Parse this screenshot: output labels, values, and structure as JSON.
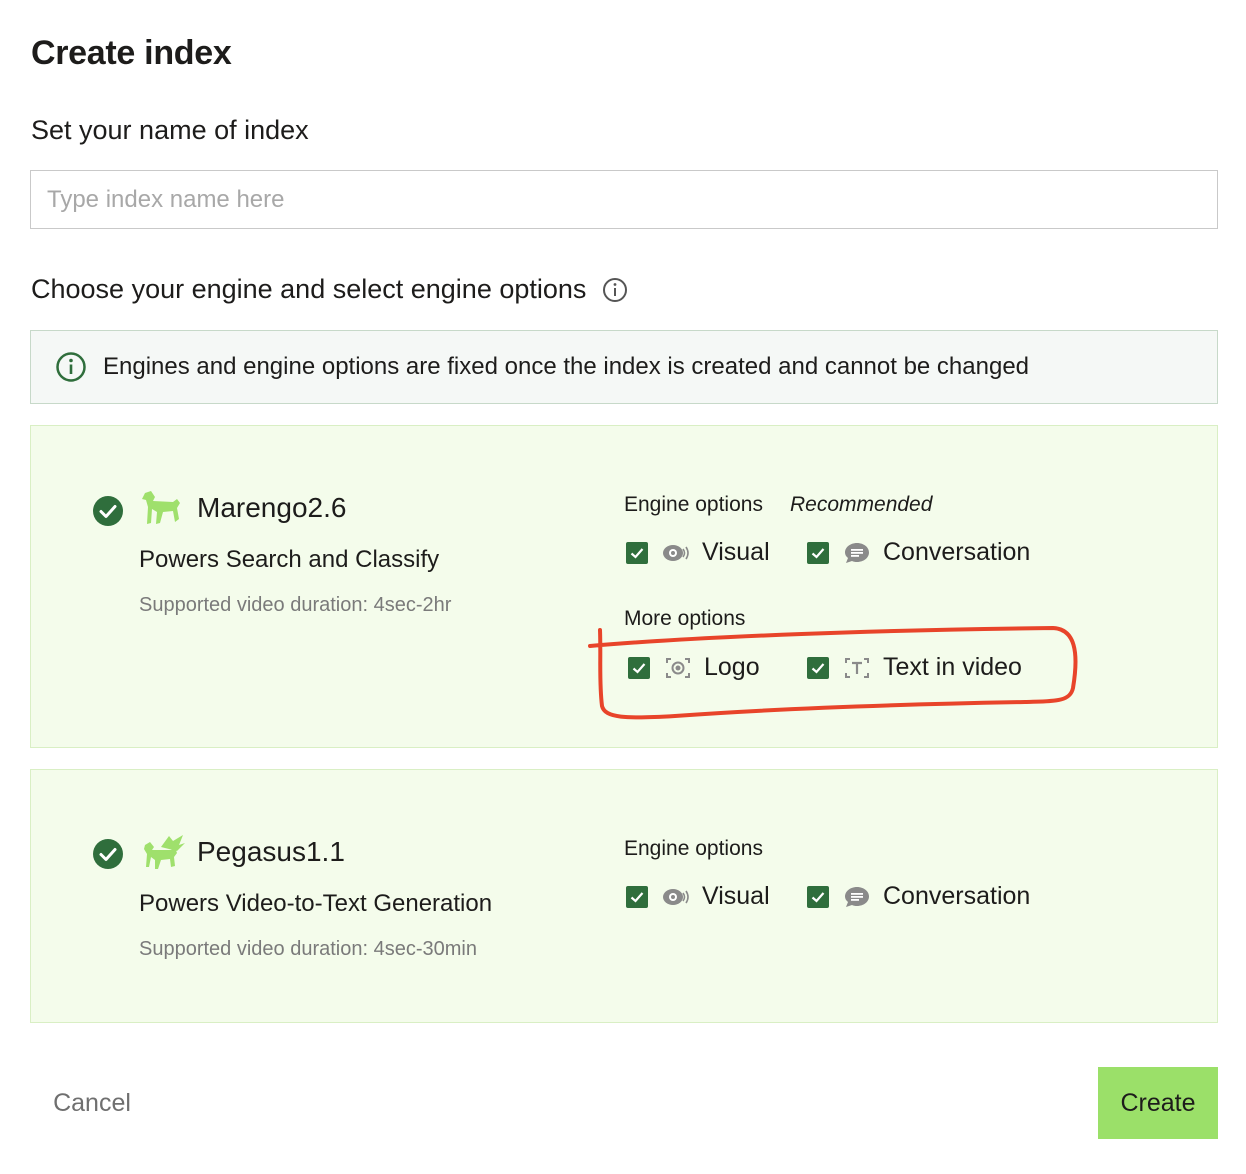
{
  "dialog": {
    "title": "Create index"
  },
  "name_section": {
    "heading": "Set your name of index",
    "placeholder": "Type index name here",
    "value": ""
  },
  "engine_section": {
    "heading": "Choose your engine and select engine options",
    "notice": "Engines and engine options are fixed once the index is created and cannot be changed"
  },
  "engines": [
    {
      "name": "Marengo2.6",
      "description": "Powers Search and Classify",
      "duration": "Supported video duration: 4sec-2hr",
      "selected": true,
      "options_heading": "Engine options",
      "options_badge": "Recommended",
      "options": [
        {
          "label": "Visual",
          "checked": true,
          "icon": "visual-icon"
        },
        {
          "label": "Conversation",
          "checked": true,
          "icon": "conversation-icon"
        }
      ],
      "more_heading": "More options",
      "more_options": [
        {
          "label": "Logo",
          "checked": true,
          "icon": "logo-icon"
        },
        {
          "label": "Text in video",
          "checked": true,
          "icon": "text-in-video-icon"
        }
      ]
    },
    {
      "name": "Pegasus1.1",
      "description": "Powers Video-to-Text Generation",
      "duration": "Supported video duration: 4sec-30min",
      "selected": true,
      "options_heading": "Engine options",
      "options": [
        {
          "label": "Visual",
          "checked": true,
          "icon": "visual-icon"
        },
        {
          "label": "Conversation",
          "checked": true,
          "icon": "conversation-icon"
        }
      ]
    }
  ],
  "footer": {
    "cancel": "Cancel",
    "create": "Create"
  },
  "colors": {
    "accent_green": "#2f6e3c",
    "create_button": "#9be069",
    "card_bg": "#f4fceb",
    "annotation": "#e8442a"
  }
}
